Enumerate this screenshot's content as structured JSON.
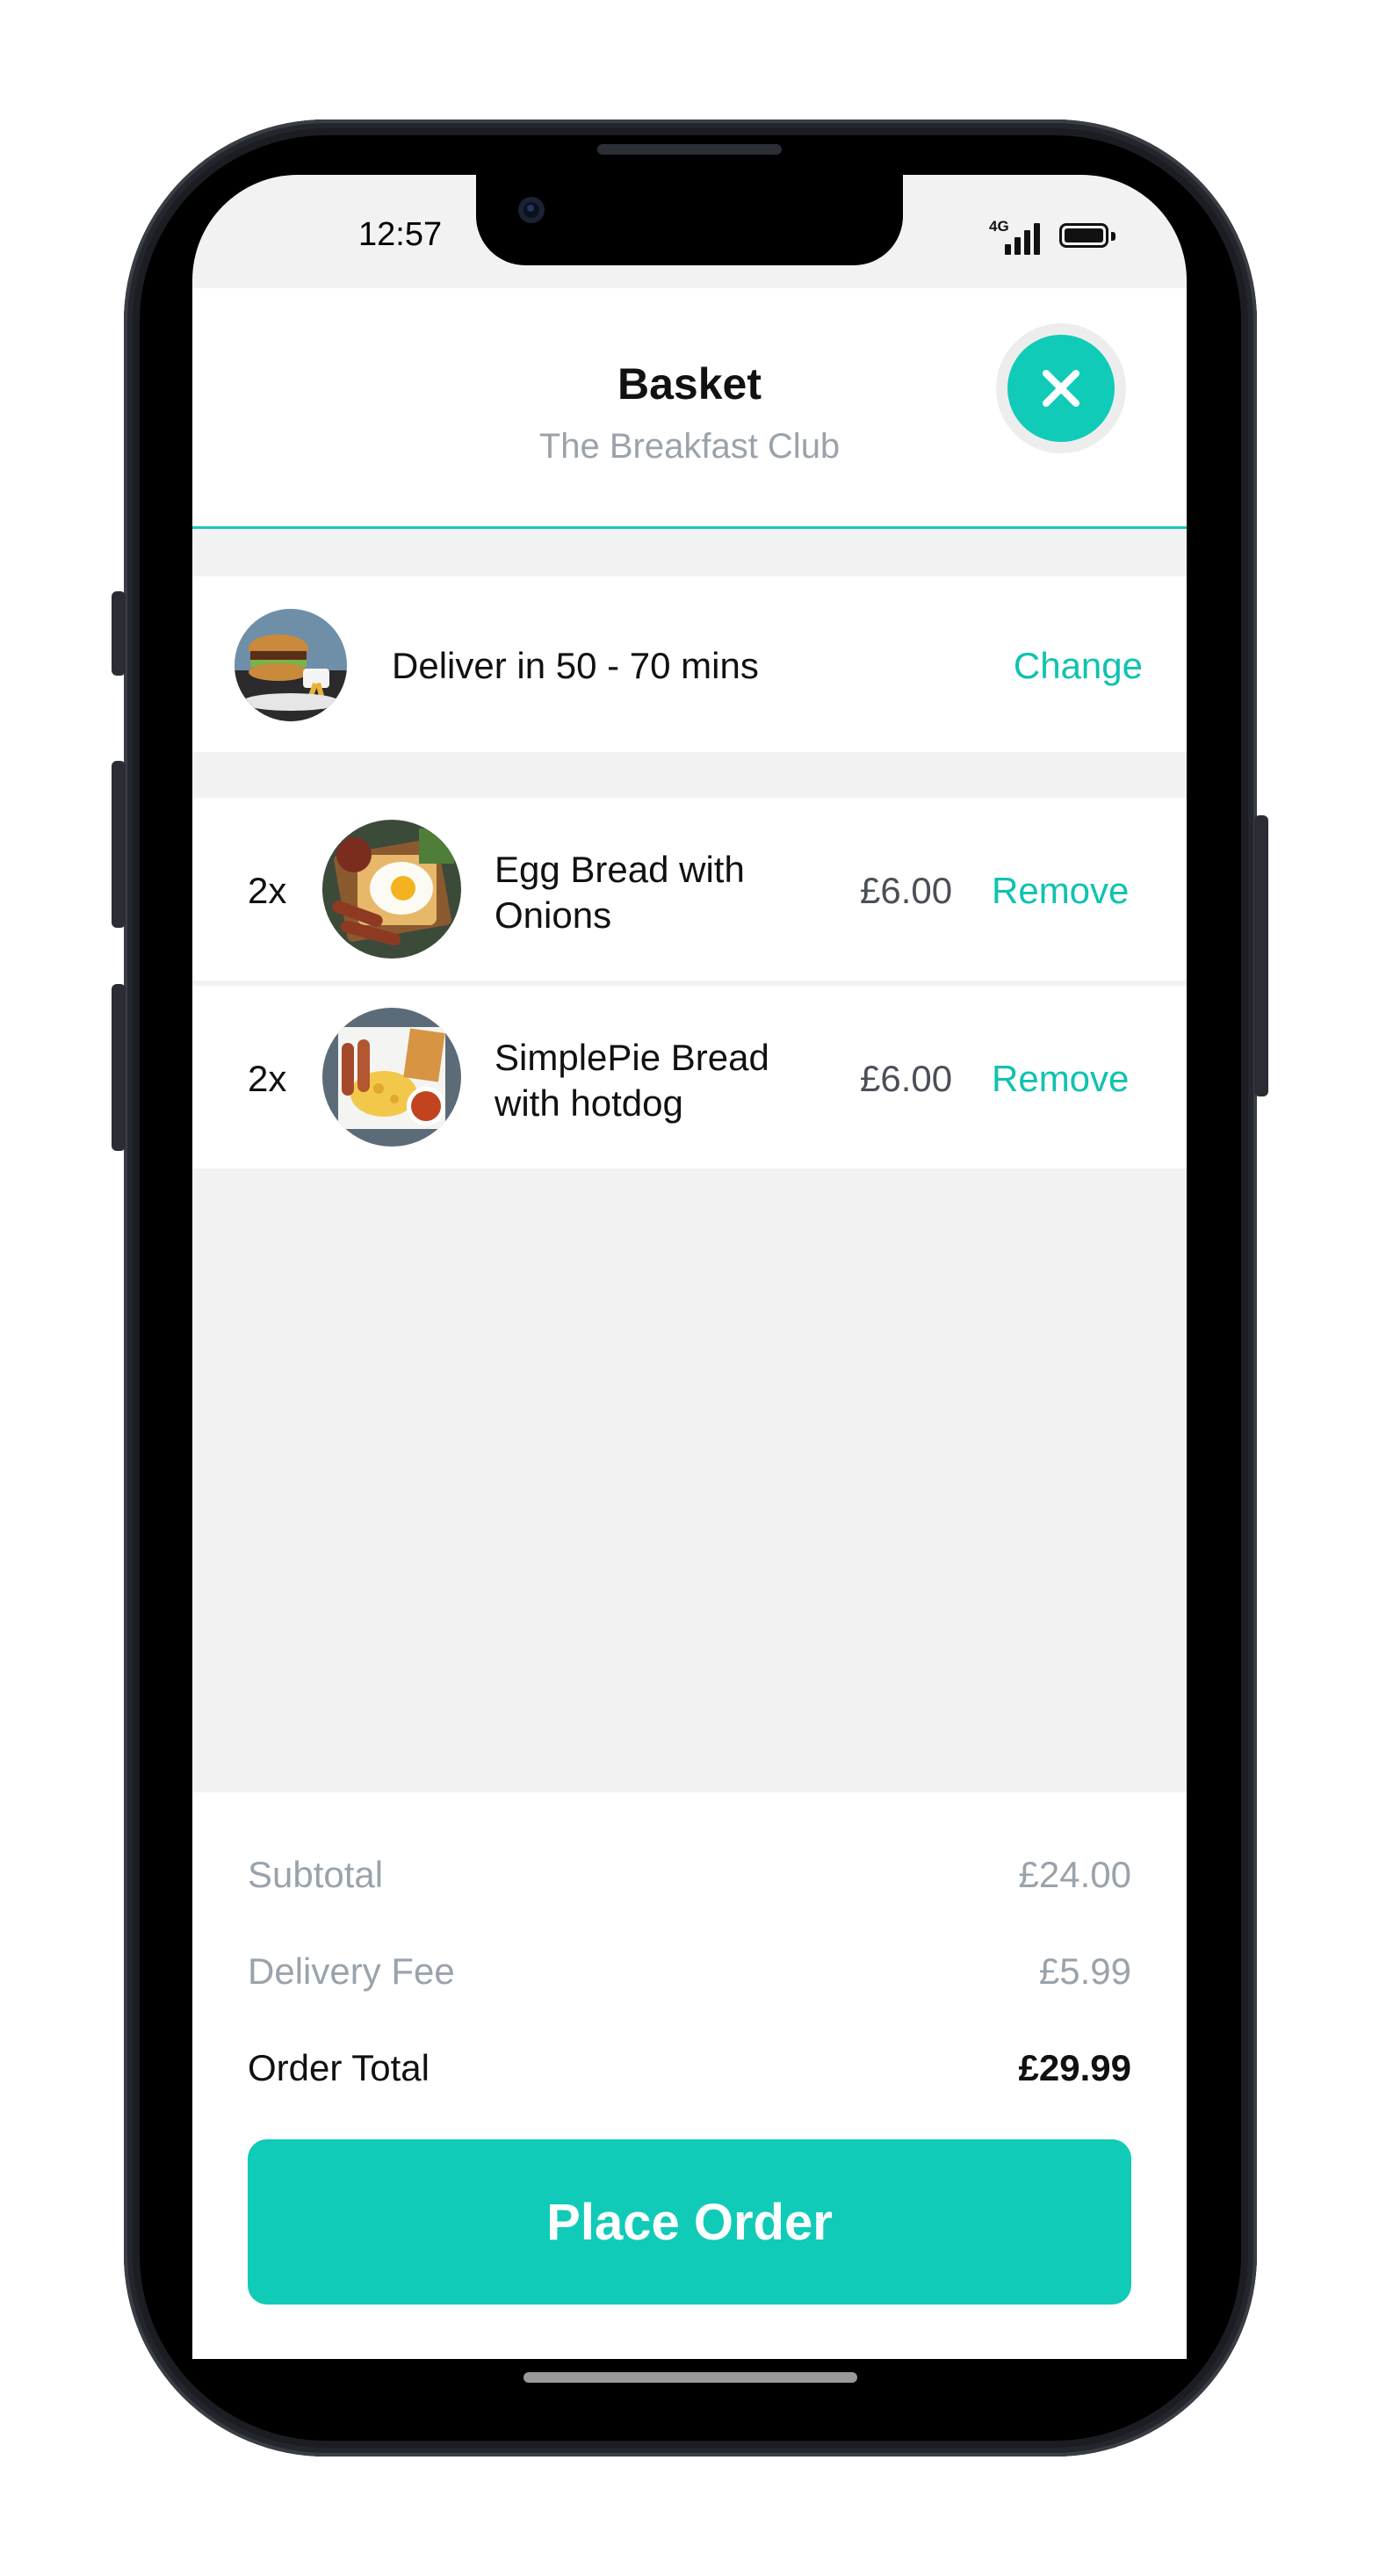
{
  "status_bar": {
    "time": "12:57",
    "network": "4G",
    "battery_level": 1.0
  },
  "header": {
    "title": "Basket",
    "subtitle": "The Breakfast Club",
    "close_icon": "close-icon"
  },
  "delivery": {
    "text": "Deliver in 50 - 70 mins",
    "change_label": "Change"
  },
  "items": [
    {
      "qty": "2x",
      "name": "Egg Bread with Onions",
      "price": "£6.00",
      "remove_label": "Remove"
    },
    {
      "qty": "2x",
      "name": "SimplePie Bread with hotdog",
      "price": "£6.00",
      "remove_label": "Remove"
    }
  ],
  "summary": {
    "subtotal_label": "Subtotal",
    "subtotal_value": "£24.00",
    "delivery_fee_label": "Delivery Fee",
    "delivery_fee_value": "£5.99",
    "total_label": "Order Total",
    "total_value": "£29.99"
  },
  "actions": {
    "place_order_label": "Place Order"
  },
  "colors": {
    "accent": "#10cbb8",
    "link": "#10c2b0",
    "muted_text": "#9aa3ab",
    "background": "#f2f2f2"
  }
}
